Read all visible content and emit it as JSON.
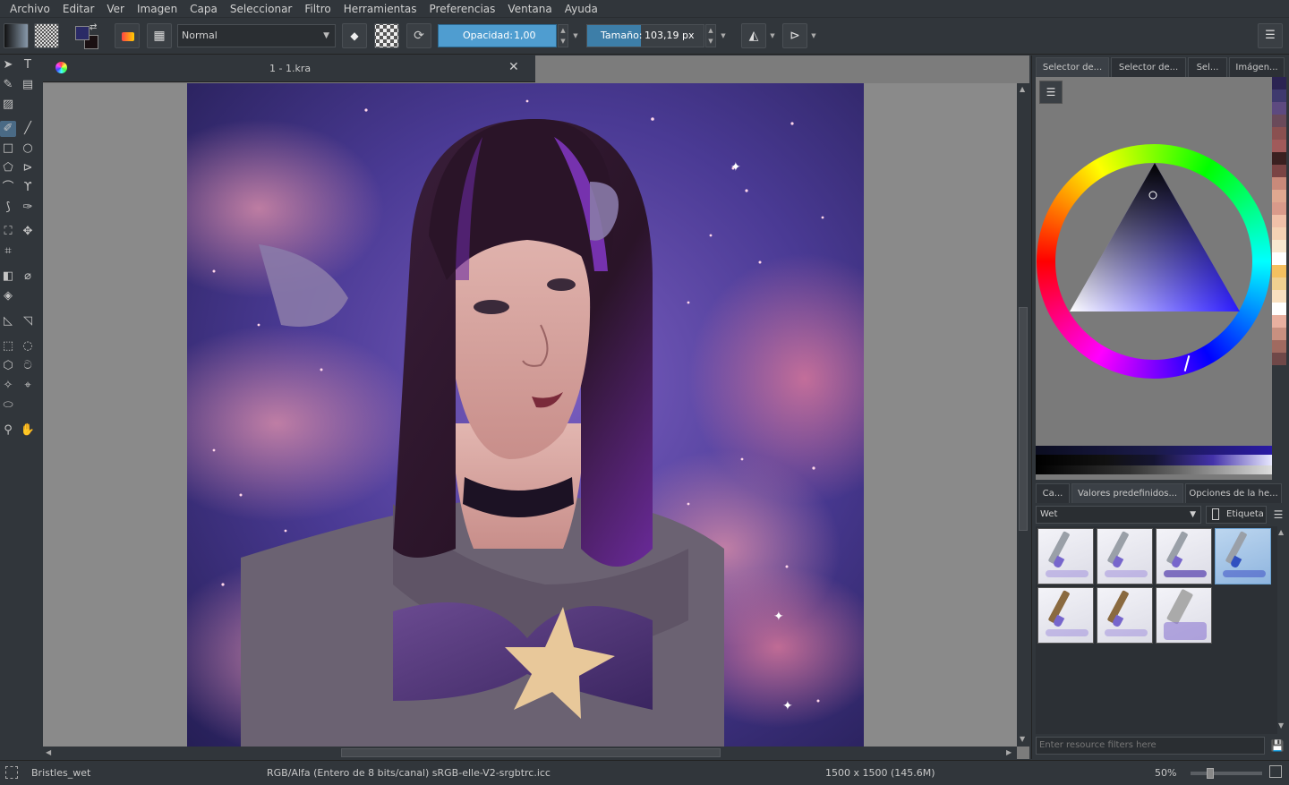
{
  "menu": [
    "Archivo",
    "Editar",
    "Ver",
    "Imagen",
    "Capa",
    "Seleccionar",
    "Filtro",
    "Herramientas",
    "Preferencias",
    "Ventana",
    "Ayuda"
  ],
  "toolbar": {
    "blend_mode": "Normal",
    "opacity_label": "Opacidad:",
    "opacity_value": "1,00",
    "size_label": "Tamaño:",
    "size_value": "103,19 px"
  },
  "document": {
    "tab_title": "1 - 1.kra"
  },
  "docker": {
    "tabs": [
      "Selector de...",
      "Selector de...",
      "Sel...",
      "Imágen..."
    ],
    "palette": [
      "#2b2352",
      "#3f3a6e",
      "#5d4a80",
      "#6a4a5a",
      "#8a5050",
      "#a05a5a",
      "#3a2020",
      "#7a4444",
      "#c98a7a",
      "#e0a890",
      "#d99a8a",
      "#f0c0a8",
      "#f4d2b4",
      "#f8e8d0",
      "#ffffff",
      "#f4c060",
      "#f0d090",
      "#f8e0c0",
      "#ffffff",
      "#e8b0a0",
      "#c89080",
      "#a06a60",
      "#704848"
    ]
  },
  "brushes": {
    "tabs": [
      "Ca...",
      "Valores predefinidos...",
      "Opciones de la he..."
    ],
    "filter_value": "Wet",
    "tag_label": "Etiqueta",
    "resource_filter_placeholder": "Enter resource filters here"
  },
  "status": {
    "brush_name": "Bristles_wet",
    "color_info": "RGB/Alfa (Entero de 8 bits/canal)  sRGB-elle-V2-srgbtrc.icc",
    "dimensions": "1500 x 1500 (145.6M)",
    "zoom": "50%"
  }
}
